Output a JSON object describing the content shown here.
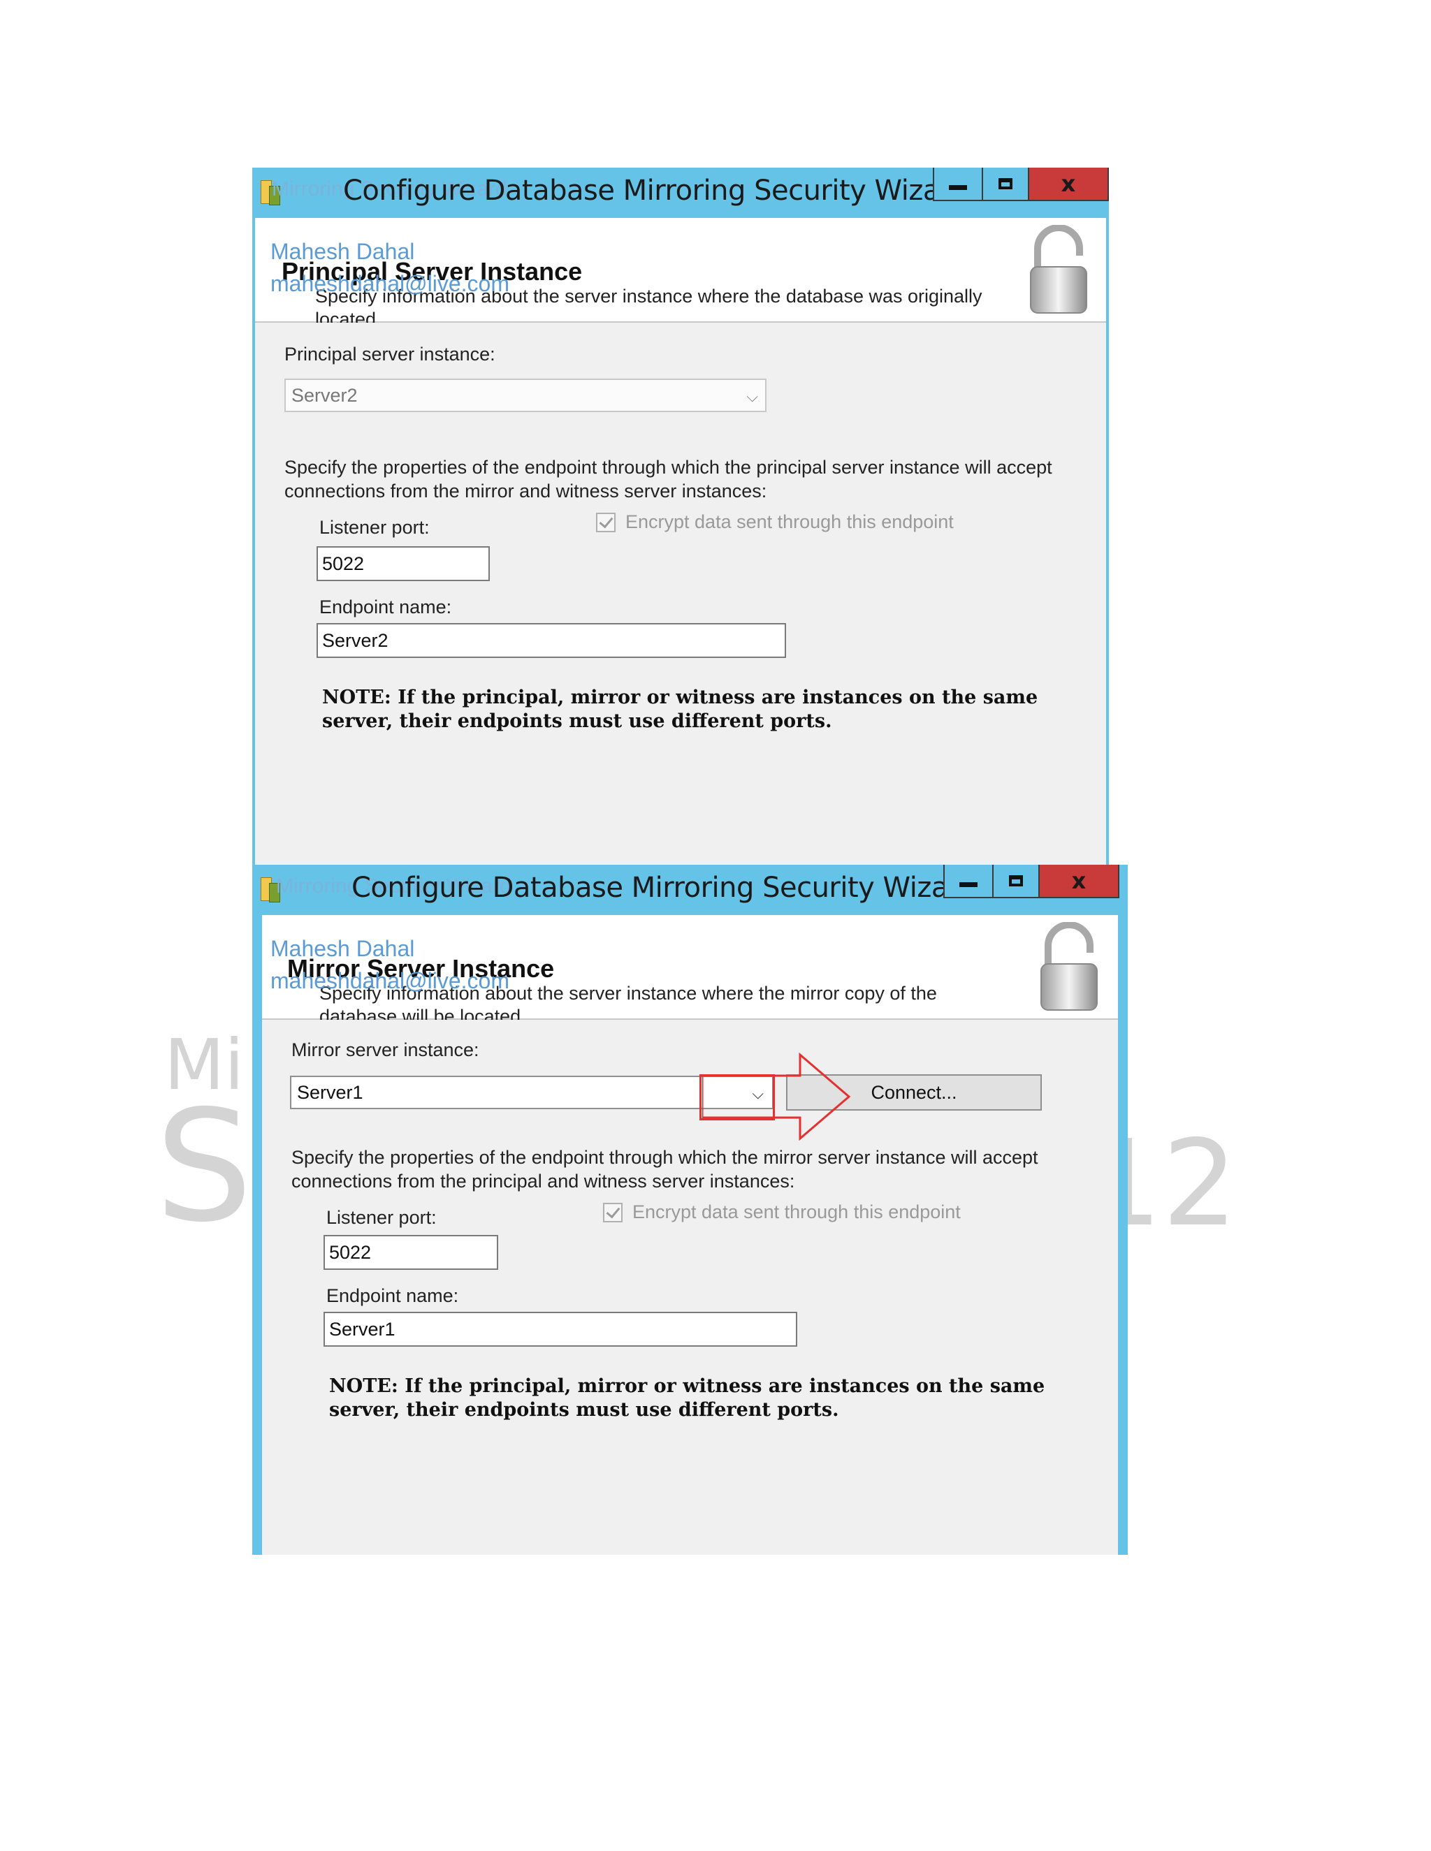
{
  "background_watermark": {
    "left": "Mi",
    "letter": "S",
    "right": "12"
  },
  "dialogs": [
    {
      "window_title": "Configure Database Mirroring Security Wizard",
      "watermark_title": "Mirroring Security Wizard",
      "watermark_author": "Mahesh Dahal",
      "watermark_email": "maheshdahal@live.com",
      "page_title": "Principal Server Instance",
      "page_description": "Specify information about the server instance where the database was originally located.",
      "instance_label": "Principal server instance:",
      "instance_value": "Server2",
      "endpoint_description": "Specify the properties of the endpoint through which the principal server instance will accept connections from the mirror and witness server instances:",
      "listener_port_label": "Listener port:",
      "listener_port_value": "5022",
      "encrypt_label": "Encrypt data sent through this endpoint",
      "endpoint_name_label": "Endpoint name:",
      "endpoint_name_value": "Server2",
      "note": "NOTE: If the principal, mirror or witness are instances on the same server, their endpoints must use different ports.",
      "buttons": {
        "minimize": "minimize",
        "maximize": "maximize",
        "close": "x"
      }
    },
    {
      "window_title": "Configure Database Mirroring Security Wizard",
      "watermark_title": "Mirroring Security Wizard",
      "watermark_author": "Mahesh Dahal",
      "watermark_email": "maheshdahal@live.com",
      "page_title": "Mirror Server Instance",
      "page_description": "Specify information about the server instance where the mirror copy of the database will be located.",
      "instance_label": "Mirror server instance:",
      "instance_value": "Server1",
      "connect_label": "Connect...",
      "endpoint_description": "Specify the properties of the endpoint through which the mirror server instance will accept connections from the principal and witness server instances:",
      "listener_port_label": "Listener port:",
      "listener_port_value": "5022",
      "encrypt_label": "Encrypt data sent through this endpoint",
      "endpoint_name_label": "Endpoint name:",
      "endpoint_name_value": "Server1",
      "note": "NOTE: If the principal, mirror or witness are instances on the same server, their endpoints must use different ports.",
      "buttons": {
        "minimize": "minimize",
        "maximize": "maximize",
        "close": "x"
      }
    }
  ],
  "colors": {
    "title_bar": "#65c3e8",
    "close_button": "#c93a3a",
    "annotation": "#e53030",
    "watermark_text": "#5b9bd5"
  }
}
